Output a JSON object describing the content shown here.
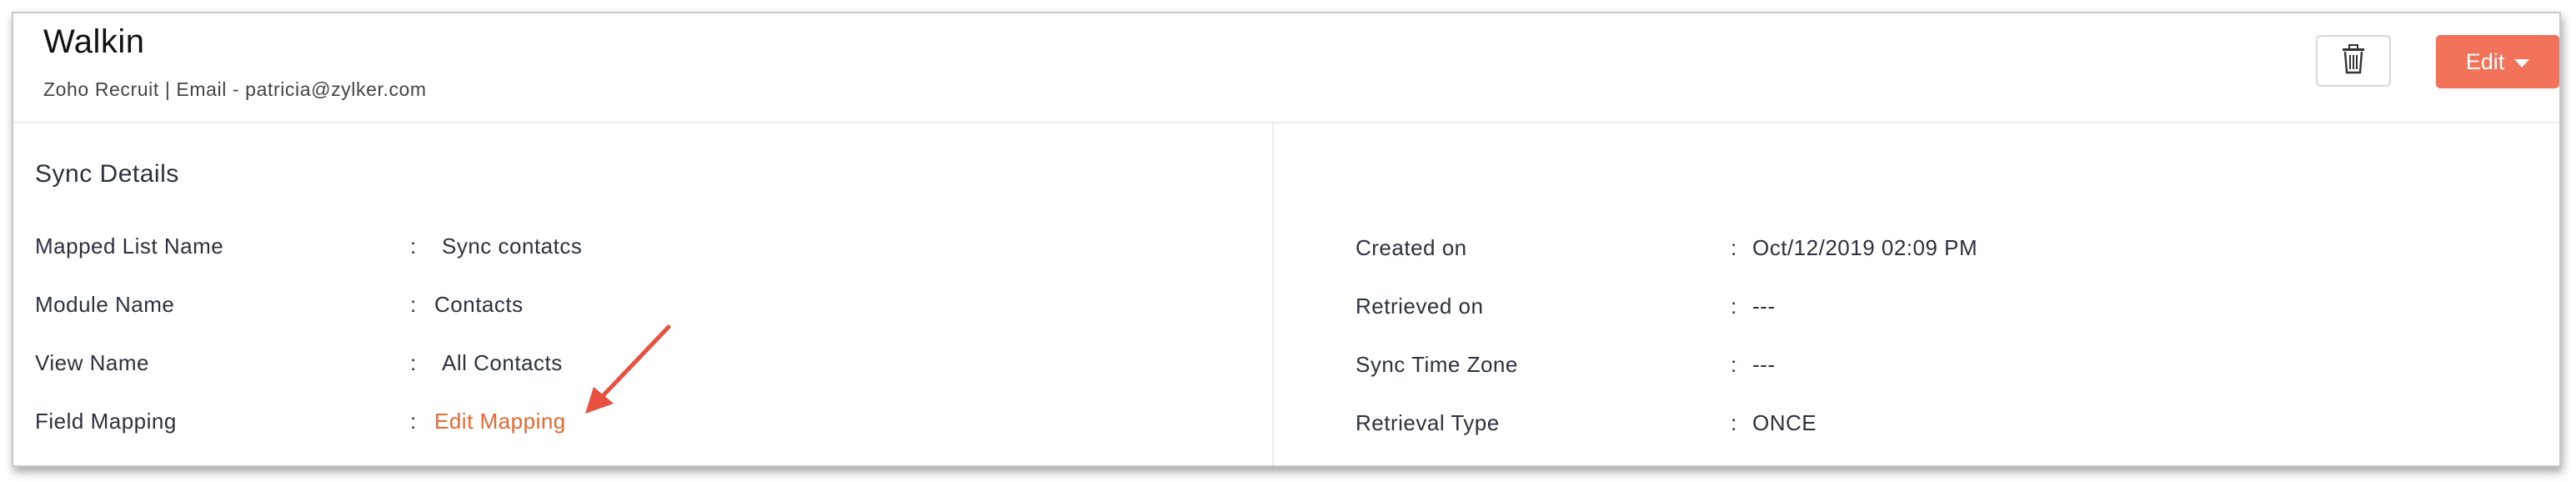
{
  "header": {
    "title": "Walkin",
    "subtitle": "Zoho Recruit | Email - patricia@zylker.com",
    "delete_icon": "trash-icon",
    "edit_label": "Edit"
  },
  "section": {
    "title": "Sync Details"
  },
  "left_rows": [
    {
      "label": "Mapped List Name",
      "value": "Sync contatcs"
    },
    {
      "label": "Module Name",
      "value": "Contacts"
    },
    {
      "label": "View Name",
      "value": "All Contacts"
    },
    {
      "label": "Field Mapping",
      "value": "Edit Mapping"
    }
  ],
  "right_rows": [
    {
      "label": "Created on",
      "value": "Oct/12/2019 02:09 PM"
    },
    {
      "label": "Retrieved on",
      "value": "---"
    },
    {
      "label": "Sync Time Zone",
      "value": "---"
    },
    {
      "label": "Retrieval Type",
      "value": "ONCE"
    }
  ],
  "colon": ":",
  "colors": {
    "accent": "#f2735a",
    "link": "#e8672f",
    "arrow": "#e8503f"
  }
}
